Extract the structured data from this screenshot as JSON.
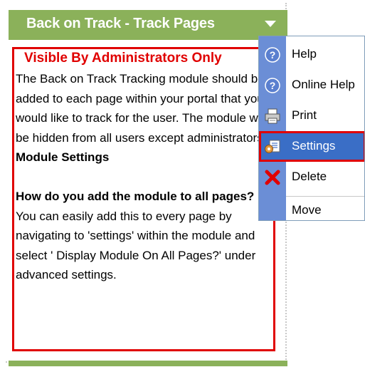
{
  "module": {
    "title": "Back on Track - Track Pages",
    "admin_notice": "Visible By Administrators Only",
    "body": {
      "intro": "The Back on Track Tracking module should be added to each page within your portal that you would like to track for the user. The module will be hidden from all users except administrators.",
      "settings_heading": "Module Settings",
      "faq_question": "How do you add the module to all pages?",
      "faq_answer": " You can easily add this to every page by navigating to 'settings' within the module and select ' Display Module On All Pages?' under advanced settings."
    }
  },
  "menu": {
    "items": [
      {
        "label": "Help",
        "icon": "help-icon"
      },
      {
        "label": "Online Help",
        "icon": "online-help-icon"
      },
      {
        "label": "Print",
        "icon": "print-icon"
      },
      {
        "label": "Settings",
        "icon": "settings-icon",
        "selected": true
      },
      {
        "label": "Delete",
        "icon": "delete-icon"
      },
      {
        "label": "Move",
        "icon": ""
      }
    ]
  },
  "colors": {
    "title_bar": "#8bb15a",
    "highlight_border": "#e00000",
    "menu_gutter": "#6b8ed6",
    "menu_selected": "#3a6ec6"
  }
}
